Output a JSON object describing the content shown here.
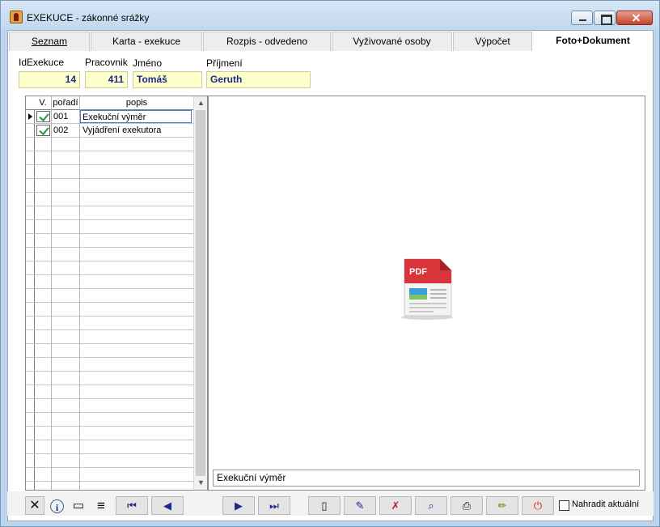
{
  "window": {
    "title": "EXEKUCE - zákonné srážky"
  },
  "tabs": [
    {
      "label": "Seznam",
      "active": false
    },
    {
      "label": "Karta - exekuce",
      "active": false
    },
    {
      "label": "Rozpis - odvedeno",
      "active": false
    },
    {
      "label": "Vyživované osoby",
      "active": false
    },
    {
      "label": "Výpočet",
      "active": false
    },
    {
      "label": "Foto+Dokument",
      "active": true
    }
  ],
  "form": {
    "id_label": "IdExekuce",
    "id_value": "14",
    "pracovnik_label": "Pracovnik",
    "pracovnik_value": "411",
    "jmeno_label": "Jméno",
    "jmeno_value": "Tomáš",
    "prijmeni_label": "Příjmení",
    "prijmeni_value": "Geruth"
  },
  "grid": {
    "columns": [
      "V.",
      "pořadí",
      "popis"
    ],
    "rows": [
      {
        "checked": true,
        "poradi": "001",
        "popis": "Exekuční výměr",
        "current": true
      },
      {
        "checked": true,
        "poradi": "002",
        "popis": "Vyjádření exekutora",
        "current": false
      }
    ]
  },
  "preview": {
    "icon": "pdf-file-icon",
    "pdf_label": "PDF",
    "caption": "Exekuční výměr"
  },
  "toolbar": {
    "icons": [
      "close-x-icon",
      "info-icon",
      "scanner-icon",
      "list-icon",
      "first-record-icon",
      "previous-record-icon",
      "next-record-icon",
      "last-record-icon",
      "new-document-icon",
      "edit-document-icon",
      "delete-document-icon",
      "preview-document-icon",
      "print-icon",
      "edit-pencil-icon",
      "power-icon"
    ],
    "replace_label": "Nahradit aktuální",
    "replace_checked": false
  },
  "colors": {
    "field_bg": "#ffffcc",
    "field_text": "#1a2b8c",
    "title_bar": "#c2d7ee",
    "close_button": "#c4402a"
  }
}
